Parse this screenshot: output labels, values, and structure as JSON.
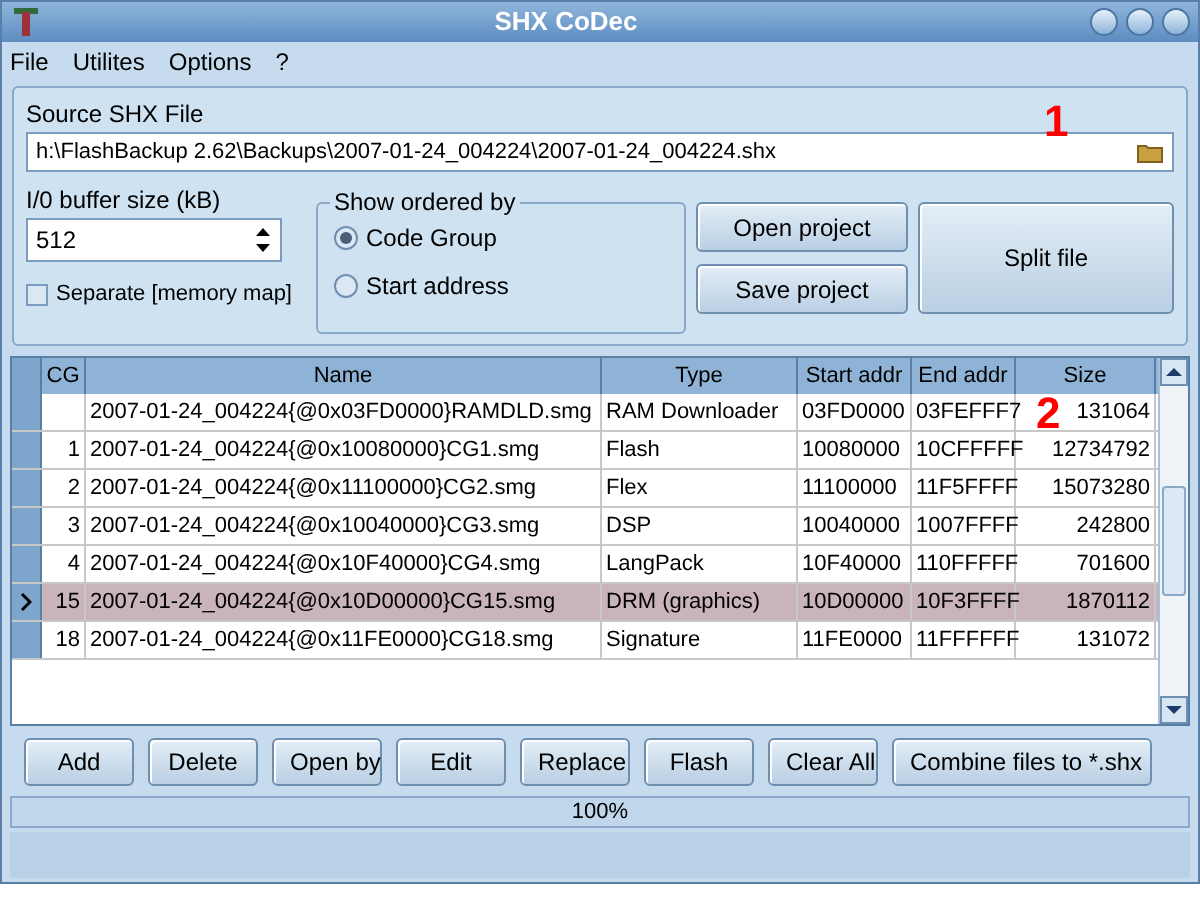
{
  "window": {
    "title": "SHX CoDec"
  },
  "menu": [
    "File",
    "Utilites",
    "Options",
    "?"
  ],
  "source": {
    "label": "Source SHX File",
    "value": "h:\\FlashBackup 2.62\\Backups\\2007-01-24_004224\\2007-01-24_004224.shx"
  },
  "buffer": {
    "label": "I/0 buffer size (kB)",
    "value": "512"
  },
  "separate": {
    "label": "Separate [memory map]",
    "checked": false
  },
  "order": {
    "title": "Show ordered by",
    "options": [
      {
        "label": "Code Group",
        "selected": true
      },
      {
        "label": "Start address",
        "selected": false
      }
    ]
  },
  "project_buttons": [
    "Open project",
    "Save project"
  ],
  "split_button": "Split file",
  "table": {
    "columns": [
      "CG",
      "Name",
      "Type",
      "Start addr",
      "End addr",
      "Size"
    ],
    "rows": [
      {
        "cells": [
          "",
          "2007-01-24_004224{@0x03FD0000}RAMDLD.smg",
          "RAM Downloader",
          "03FD0000",
          "03FEFFF7",
          "131064"
        ],
        "selected": false
      },
      {
        "cells": [
          "1",
          "2007-01-24_004224{@0x10080000}CG1.smg",
          "Flash",
          "10080000",
          "10CFFFFF",
          "12734792"
        ],
        "selected": false
      },
      {
        "cells": [
          "2",
          "2007-01-24_004224{@0x11100000}CG2.smg",
          "Flex",
          "11100000",
          "11F5FFFF",
          "15073280"
        ],
        "selected": false
      },
      {
        "cells": [
          "3",
          "2007-01-24_004224{@0x10040000}CG3.smg",
          "DSP",
          "10040000",
          "1007FFFF",
          "242800"
        ],
        "selected": false
      },
      {
        "cells": [
          "4",
          "2007-01-24_004224{@0x10F40000}CG4.smg",
          "LangPack",
          "10F40000",
          "110FFFFF",
          "701600"
        ],
        "selected": false
      },
      {
        "cells": [
          "15",
          "2007-01-24_004224{@0x10D00000}CG15.smg",
          "DRM (graphics)",
          "10D00000",
          "10F3FFFF",
          "1870112"
        ],
        "selected": true
      },
      {
        "cells": [
          "18",
          "2007-01-24_004224{@0x11FE0000}CG18.smg",
          "Signature",
          "11FE0000",
          "11FFFFFF",
          "131072"
        ],
        "selected": false
      }
    ]
  },
  "buttons": [
    "Add",
    "Delete",
    "Open by",
    "Edit",
    "Replace",
    "Flash",
    "Clear All",
    "Combine files to *.shx"
  ],
  "progress": {
    "level": 1,
    "reading": "100%"
  },
  "annotations": [
    "1",
    "2"
  ]
}
